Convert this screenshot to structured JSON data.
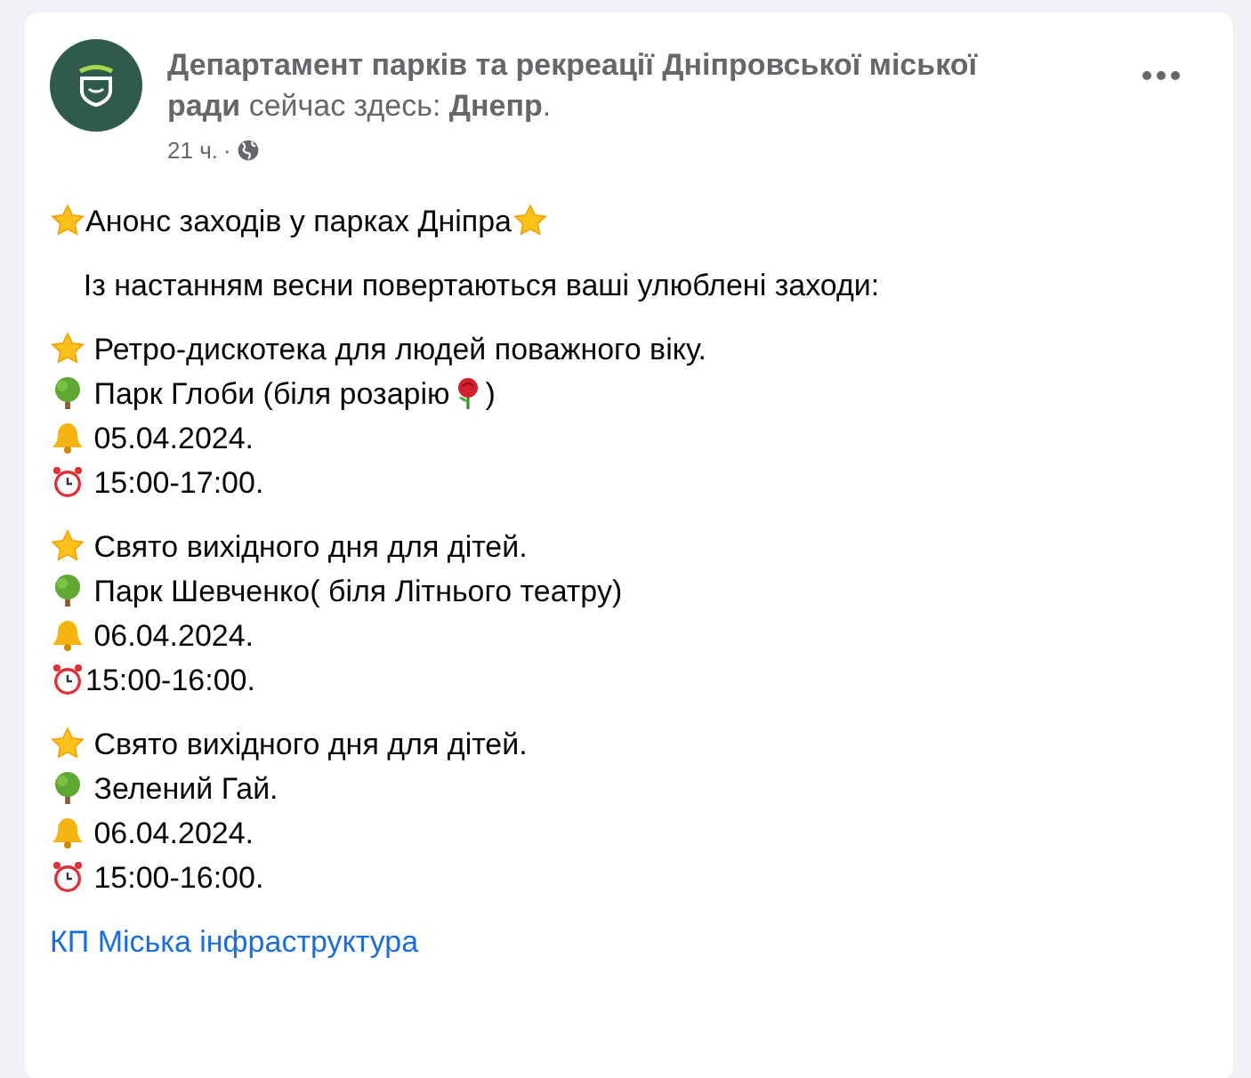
{
  "post": {
    "header": "**Департамент парків та рекреації Дніпровської міської ради** сейчас здесь: **Днепр**.",
    "time": "21 ч.",
    "separator": "·",
    "paragraphs": [
      {
        "lines": [
          [
            {
              "kind": "star"
            },
            {
              "kind": "text",
              "text": "Анонс заходів у парках Дніпра"
            },
            {
              "kind": "star"
            }
          ]
        ]
      },
      {
        "lines": [
          [
            {
              "kind": "text",
              "text": "    Із настанням весни повертаються ваші улюблені заходи:"
            }
          ]
        ]
      },
      {
        "lines": [
          [
            {
              "kind": "star"
            },
            {
              "kind": "text",
              "text": " Ретро-дискотека для людей поважного віку."
            }
          ],
          [
            {
              "kind": "tree"
            },
            {
              "kind": "text",
              "text": " Парк Глоби (біля розарію"
            },
            {
              "kind": "rose"
            },
            {
              "kind": "text",
              "text": ")"
            }
          ],
          [
            {
              "kind": "bell"
            },
            {
              "kind": "text",
              "text": " 05.04.2024."
            }
          ],
          [
            {
              "kind": "clock"
            },
            {
              "kind": "text",
              "text": " 15:00-17:00."
            }
          ]
        ]
      },
      {
        "lines": [
          [
            {
              "kind": "star"
            },
            {
              "kind": "text",
              "text": " Свято вихідного дня для дітей."
            }
          ],
          [
            {
              "kind": "tree"
            },
            {
              "kind": "text",
              "text": " Парк Шевченко( біля Літнього театру)"
            }
          ],
          [
            {
              "kind": "bell"
            },
            {
              "kind": "text",
              "text": " 06.04.2024."
            }
          ],
          [
            {
              "kind": "clock"
            },
            {
              "kind": "text",
              "text": "15:00-16:00."
            }
          ]
        ]
      },
      {
        "lines": [
          [
            {
              "kind": "star"
            },
            {
              "kind": "text",
              "text": " Свято вихідного дня для дітей."
            }
          ],
          [
            {
              "kind": "tree"
            },
            {
              "kind": "text",
              "text": " Зелений Гай."
            }
          ],
          [
            {
              "kind": "bell"
            },
            {
              "kind": "text",
              "text": " 06.04.2024."
            }
          ],
          [
            {
              "kind": "clock"
            },
            {
              "kind": "text",
              "text": " 15:00-16:00."
            }
          ]
        ]
      }
    ],
    "link": "КП Міська інфраструктура"
  }
}
